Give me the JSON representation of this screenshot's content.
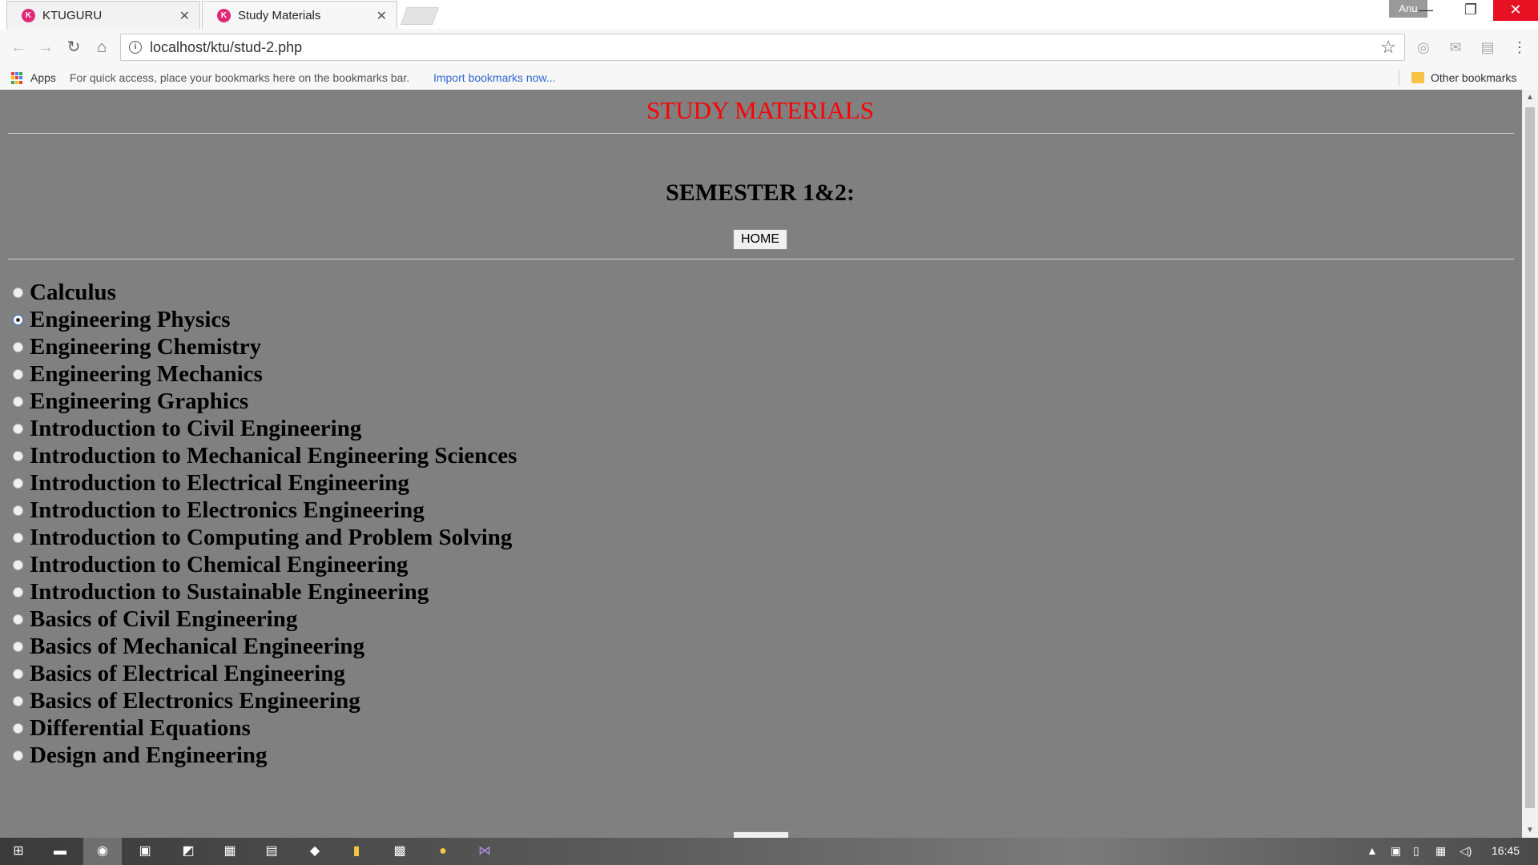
{
  "browser": {
    "tabs": [
      {
        "title": "KTUGURU",
        "favicon": "ktuguru-favicon",
        "active": false
      },
      {
        "title": "Study Materials",
        "favicon": "ktuguru-favicon",
        "active": true
      }
    ],
    "user_badge": "Anu",
    "address": "localhost/ktu/stud-2.php",
    "bookmarks_bar": {
      "apps_label": "Apps",
      "hint": "For quick access, place your bookmarks here on the bookmarks bar.",
      "import_link": "Import bookmarks now...",
      "other_bookmarks": "Other bookmarks"
    }
  },
  "page": {
    "heading": "STUDY MATERIALS",
    "semester": "SEMESTER 1&2:",
    "home_button": "HOME",
    "subjects": [
      {
        "label": "Calculus",
        "checked": false
      },
      {
        "label": "Engineering Physics",
        "checked": true
      },
      {
        "label": "Engineering Chemistry",
        "checked": false
      },
      {
        "label": "Engineering Mechanics",
        "checked": false
      },
      {
        "label": "Engineering Graphics",
        "checked": false
      },
      {
        "label": "Introduction to Civil Engineering",
        "checked": false
      },
      {
        "label": "Introduction to Mechanical Engineering Sciences",
        "checked": false
      },
      {
        "label": "Introduction to Electrical Engineering",
        "checked": false
      },
      {
        "label": "Introduction to Electronics Engineering",
        "checked": false
      },
      {
        "label": "Introduction to Computing and Problem Solving",
        "checked": false
      },
      {
        "label": "Introduction to Chemical Engineering",
        "checked": false
      },
      {
        "label": "Introduction to Sustainable Engineering",
        "checked": false
      },
      {
        "label": "Basics of Civil Engineering",
        "checked": false
      },
      {
        "label": "Basics of Mechanical Engineering",
        "checked": false
      },
      {
        "label": "Basics of Electrical Engineering",
        "checked": false
      },
      {
        "label": "Basics of Electronics Engineering",
        "checked": false
      },
      {
        "label": "Differential Equations",
        "checked": false
      },
      {
        "label": "Design and Engineering",
        "checked": false
      }
    ]
  },
  "taskbar": {
    "clock": "16:45",
    "apps": [
      "windows-start-icon",
      "terminal-icon",
      "chrome-icon",
      "app-icon",
      "photos-icon",
      "app-icon",
      "document-icon",
      "app-icon",
      "file-explorer-icon",
      "office-icon",
      "app-icon",
      "visual-studio-icon"
    ]
  },
  "colors": {
    "page_background": "#808080",
    "heading": "#ff0000",
    "close_button": "#e81123",
    "link": "#3367d6"
  }
}
